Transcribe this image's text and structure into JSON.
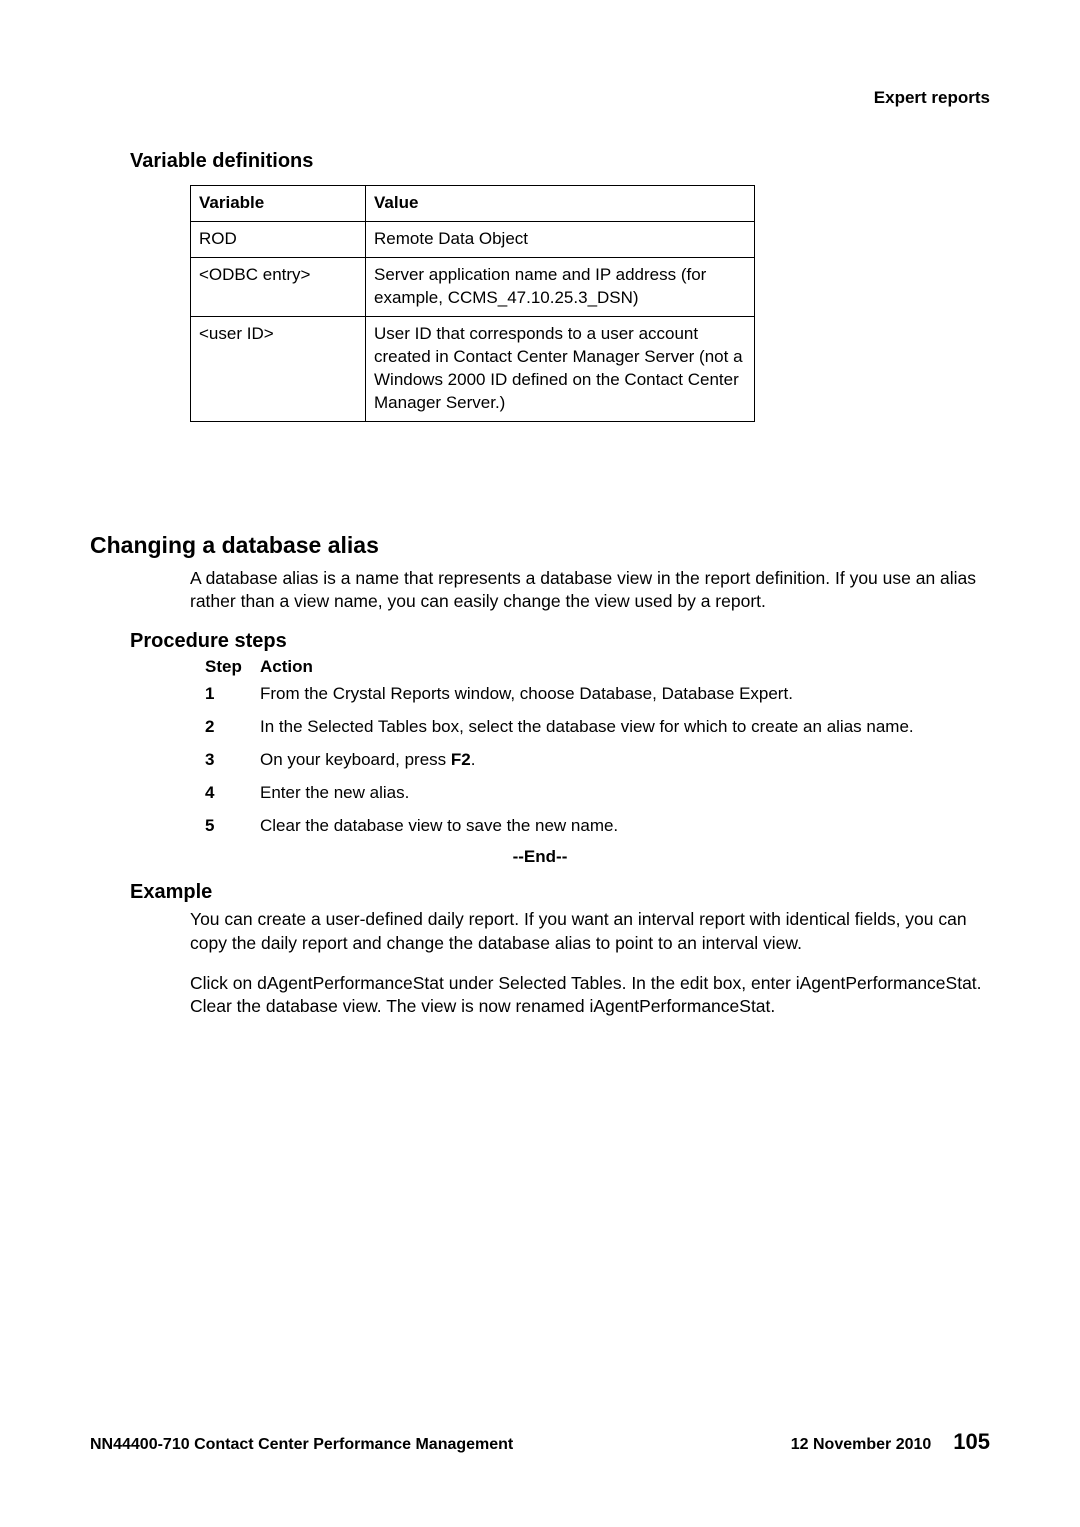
{
  "header": {
    "running": "Expert reports"
  },
  "section1": {
    "title": "Variable definitions",
    "table": {
      "head": {
        "var": "Variable",
        "val": "Value"
      },
      "rows": [
        {
          "var": "ROD",
          "val": "Remote Data Object"
        },
        {
          "var": "<ODBC entry>",
          "val": "Server application name and IP address (for example, CCMS_47.10.25.3_DSN)"
        },
        {
          "var": "<user ID>",
          "val": "User ID that corresponds to a user account created in Contact Center Manager Server (not a Windows 2000 ID defined on the Contact Center Manager Server.)"
        }
      ]
    }
  },
  "section2": {
    "title": "Changing a database alias",
    "intro": "A database alias is a name that represents a database view in the report definition. If you use an alias rather than a view name, you can easily change the view used by a report.",
    "proc_title": "Procedure steps",
    "step_label": "Step",
    "action_label": "Action",
    "steps": [
      {
        "n": "1",
        "a_pre": "From the Crystal Reports window, choose Database, Database Expert.",
        "a_bold": "",
        "a_post": ""
      },
      {
        "n": "2",
        "a_pre": "In the Selected Tables box, select the database view for which to create an alias name.",
        "a_bold": "",
        "a_post": ""
      },
      {
        "n": "3",
        "a_pre": "On your keyboard, press ",
        "a_bold": "F2",
        "a_post": "."
      },
      {
        "n": "4",
        "a_pre": "Enter the new alias.",
        "a_bold": "",
        "a_post": ""
      },
      {
        "n": "5",
        "a_pre": "Clear the database view to save the new name.",
        "a_bold": "",
        "a_post": ""
      }
    ],
    "end": "--End--",
    "example_title": "Example",
    "example_p1": "You can create a user-defined daily report. If you want an interval report with identical fields, you can copy the daily report and change the database alias to point to an interval view.",
    "example_p2": "Click on dAgentPerformanceStat under Selected Tables. In the edit box, enter iAgentPerformanceStat. Clear the database view. The view is now renamed iAgentPerformanceStat."
  },
  "footer": {
    "left": "NN44400-710 Contact Center Performance Management",
    "date": "12 November 2010",
    "page": "105"
  }
}
